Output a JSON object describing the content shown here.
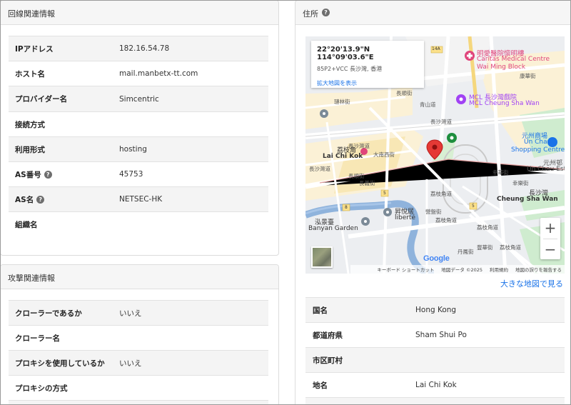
{
  "line_info": {
    "title": "回線関連情報",
    "rows": [
      {
        "key": "IPアドレス",
        "value": "182.16.54.78",
        "help": false
      },
      {
        "key": "ホスト名",
        "value": "mail.manbetx-tt.com",
        "help": false
      },
      {
        "key": "プロバイダー名",
        "value": "Simcentric",
        "help": false
      },
      {
        "key": "接続方式",
        "value": "",
        "help": false
      },
      {
        "key": "利用形式",
        "value": "hosting",
        "help": false
      },
      {
        "key": "AS番号",
        "value": "45753",
        "help": true
      },
      {
        "key": "AS名",
        "value": "NETSEC-HK",
        "help": true
      },
      {
        "key": "組織名",
        "value": "",
        "help": false
      }
    ]
  },
  "attack_info": {
    "title": "攻撃関連情報",
    "rows": [
      {
        "key": "クローラーであるか",
        "value": "いいえ"
      },
      {
        "key": "クローラー名",
        "value": ""
      },
      {
        "key": "プロキシを使用しているか",
        "value": "いいえ"
      },
      {
        "key": "プロキシの方式",
        "value": ""
      }
    ]
  },
  "address": {
    "title": "住所",
    "map": {
      "coords": "22°20'13.9\"N 114°09'03.6\"E",
      "plus_code": "85P2+VCC 長沙灣, 香港",
      "enlarge_link": "拡大地図を表示",
      "zoom_in": "+",
      "zoom_out": "−",
      "google": "Google",
      "footer": [
        "キーボード ショートカット",
        "地図データ ©2025",
        "利用規約",
        "地図の誤りを報告する"
      ],
      "labels": {
        "hospital_jp": "明愛醫院懷明樓",
        "hospital_en1": "Caritas Medical Centre",
        "hospital_en2": "Wai Ming Block",
        "mcl_cn": "MCL 長沙灣戲院",
        "mcl_en": "MCL Cheung Sha Wan",
        "road_14a": "14A",
        "kang_hua": "康華街",
        "chang_shun": "長順街",
        "qing_shan": "青山道",
        "lilin": "璉林街",
        "cheung_sha_wan_rd": "長沙灣道",
        "lai_chi_kok_cn": "荔枝角",
        "lai_chi_kok_en": "Lai Chi Kok",
        "da_nan_xi": "大南西街",
        "cheung_sha_wan_rd2": "長沙灣道",
        "cheung_shun_st": "長順街",
        "cheung_yi": "長義街",
        "lai_chi_kok_rd": "荔枝角道",
        "ching_wah": "昇悅居",
        "liberte": "liberté",
        "banyan_cn": "泓景臺",
        "banyan_en": "Banyan Garden",
        "un_chau_cn": "元州商場",
        "un_chau_en1": "Un Chau",
        "un_chau_en2": "Shopping Centre",
        "un_chau_est_cn": "元州邨",
        "un_chau_est_en": "Un Chau Estate",
        "cheung_sha_wan_cn": "長沙灣",
        "cheung_sha_wan_en": "Cheung Sha Wan",
        "hang_wah": "幸華街",
        "hang_lok": "幸樂街",
        "lai_chi_kok_rd2": "荔枝角道",
        "lai_chi_kok_rd3": "荔枝角道",
        "lai_chi_kok_rd4": "荔枝角道",
        "fung_wah": "豐華街",
        "dan_feng": "丹鳳街",
        "ying_wah": "營盤街",
        "road_5a": "5",
        "road_5b": "5",
        "road_8": "8",
        "cheung_sha_wan_rd3": "長沙灣道",
        "lai": "荔",
        "lai2": "荔",
        "chang": "長",
        "chang2": "長",
        "chang3": "長"
      }
    },
    "big_map_link": "大きな地図で見る",
    "rows": [
      {
        "key": "国名",
        "value": "Hong Kong"
      },
      {
        "key": "都道府県",
        "value": "Sham Shui Po"
      },
      {
        "key": "市区町村",
        "value": ""
      },
      {
        "key": "地名",
        "value": "Lai Chi Kok"
      }
    ]
  },
  "colors": {
    "link": "#1a73e8",
    "pin": "#e53935",
    "water": "#7aa7d6",
    "park": "#c5e8c5",
    "commercial": "#fbf0cf",
    "hospital": "#e0457b",
    "cinema": "#a142f4"
  }
}
